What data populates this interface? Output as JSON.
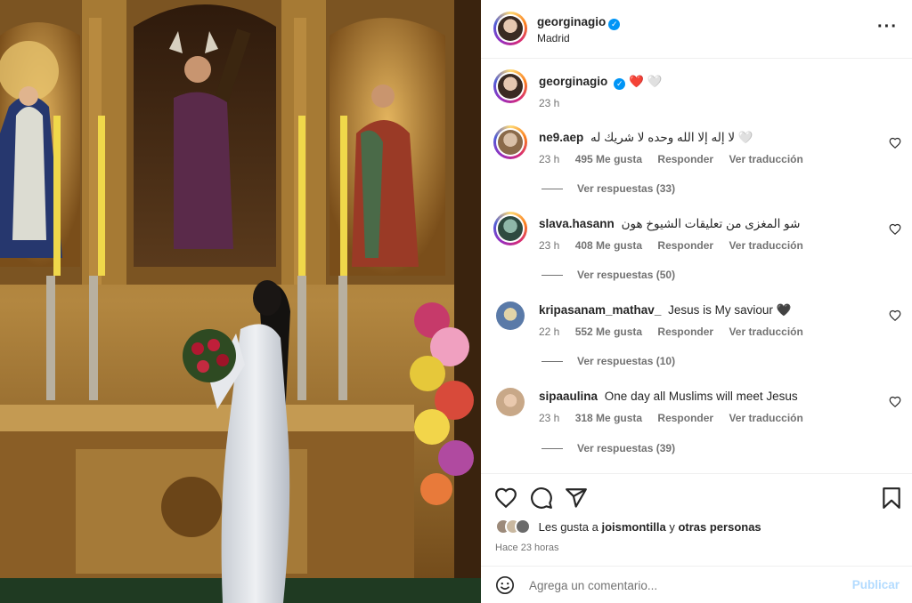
{
  "post": {
    "username": "georginagio",
    "location": "Madrid",
    "verified_icon": "verified-badge-icon",
    "more_icon": "more-options-icon"
  },
  "caption": {
    "username": "georginagio",
    "text": "❤️ 🤍",
    "time": "23 h"
  },
  "comments": [
    {
      "username": "ne9.aep",
      "text": "لا إله إلا الله وحده لا شريك له 🤍",
      "time": "23 h",
      "likes": "495 Me gusta",
      "reply_label": "Responder",
      "translate_label": "Ver traducción",
      "replies_label": "Ver respuestas (33)"
    },
    {
      "username": "slava.hasann",
      "text": "شو المغزى من تعليقات الشيوخ هون",
      "time": "23 h",
      "likes": "408 Me gusta",
      "reply_label": "Responder",
      "translate_label": "Ver traducción",
      "replies_label": "Ver respuestas (50)"
    },
    {
      "username": "kripasanam_mathav_",
      "text": "Jesus is My saviour 🖤",
      "time": "22 h",
      "likes": "552 Me gusta",
      "reply_label": "Responder",
      "translate_label": "Ver traducción",
      "replies_label": "Ver respuestas (10)"
    },
    {
      "username": "sipaaulina",
      "text": "One day all Muslims will meet Jesus",
      "time": "23 h",
      "likes": "318 Me gusta",
      "reply_label": "Responder",
      "translate_label": "Ver traducción",
      "replies_label": "Ver respuestas (39)"
    }
  ],
  "actions": {
    "like_icon": "heart-icon",
    "comment_icon": "comment-icon",
    "share_icon": "share-icon",
    "save_icon": "bookmark-icon"
  },
  "likes": {
    "prefix": "Les gusta a",
    "user": "joismontilla",
    "connector": "y",
    "others": "otras personas"
  },
  "posted_ago": "Hace 23 horas",
  "add_comment": {
    "emoji_icon": "emoji-icon",
    "placeholder": "Agrega un comentario...",
    "publish_label": "Publicar"
  },
  "colors": {
    "accent": "#0095f6",
    "publish_disabled": "#b3dbff",
    "muted_text": "#737373"
  }
}
